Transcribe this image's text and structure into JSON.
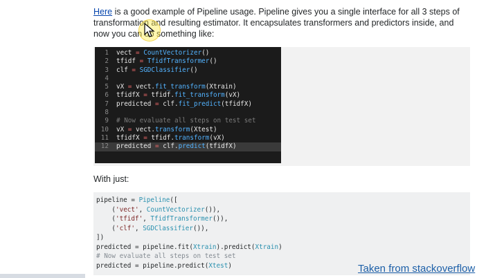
{
  "intro": {
    "link_text": "Here",
    "text": " is a good example of Pipeline usage. Pipeline gives you a single interface for all 3 steps of transformation and resulting estimator. It encapsulates transformers and predictors inside, and now you can do something like:"
  },
  "dark_code": {
    "lines": [
      {
        "num": "1",
        "parts": [
          [
            "pl",
            "vect "
          ],
          [
            "op",
            "="
          ],
          [
            "pl",
            " "
          ],
          [
            "fn",
            "CountVectorizer"
          ],
          [
            "pl",
            "()"
          ]
        ]
      },
      {
        "num": "2",
        "parts": [
          [
            "pl",
            "tfidf "
          ],
          [
            "op",
            "="
          ],
          [
            "pl",
            " "
          ],
          [
            "fn",
            "TfidfTransformer"
          ],
          [
            "pl",
            "()"
          ]
        ]
      },
      {
        "num": "3",
        "parts": [
          [
            "pl",
            "clf "
          ],
          [
            "op",
            "="
          ],
          [
            "pl",
            " "
          ],
          [
            "fn",
            "SGDClassifier"
          ],
          [
            "pl",
            "()"
          ]
        ]
      },
      {
        "num": "4",
        "parts": []
      },
      {
        "num": "5",
        "parts": [
          [
            "pl",
            "vX "
          ],
          [
            "op",
            "="
          ],
          [
            "pl",
            " vect."
          ],
          [
            "fn",
            "fit_transform"
          ],
          [
            "pl",
            "(Xtrain)"
          ]
        ]
      },
      {
        "num": "6",
        "parts": [
          [
            "pl",
            "tfidfX "
          ],
          [
            "op",
            "="
          ],
          [
            "pl",
            " tfidf."
          ],
          [
            "fn",
            "fit_transform"
          ],
          [
            "pl",
            "(vX)"
          ]
        ]
      },
      {
        "num": "7",
        "parts": [
          [
            "pl",
            "predicted "
          ],
          [
            "op",
            "="
          ],
          [
            "pl",
            " clf."
          ],
          [
            "fn",
            "fit_predict"
          ],
          [
            "pl",
            "(tfidfX)"
          ]
        ]
      },
      {
        "num": "8",
        "parts": []
      },
      {
        "num": "9",
        "parts": [
          [
            "cm",
            "# Now evaluate all steps on test set"
          ]
        ]
      },
      {
        "num": "10",
        "parts": [
          [
            "pl",
            "vX "
          ],
          [
            "op",
            "="
          ],
          [
            "pl",
            " vect."
          ],
          [
            "fn",
            "transform"
          ],
          [
            "pl",
            "(Xtest)"
          ]
        ]
      },
      {
        "num": "11",
        "parts": [
          [
            "pl",
            "tfidfX "
          ],
          [
            "op",
            "="
          ],
          [
            "pl",
            " tfidf."
          ],
          [
            "fn",
            "transform"
          ],
          [
            "pl",
            "(vX)"
          ]
        ]
      },
      {
        "num": "12",
        "parts": [
          [
            "pl",
            "predicted "
          ],
          [
            "op",
            "="
          ],
          [
            "pl",
            " clf."
          ],
          [
            "fn",
            "predict"
          ],
          [
            "pl",
            "(tfidfX)"
          ]
        ],
        "highlight": true
      }
    ]
  },
  "with_just": "With just:",
  "light_code": {
    "lines": [
      [
        [
          "pl",
          "pipeline = "
        ],
        [
          "kw",
          "Pipeline"
        ],
        [
          "pl",
          "(["
        ]
      ],
      [
        [
          "pl",
          "    ("
        ],
        [
          "str",
          "'vect'"
        ],
        [
          "pl",
          ", "
        ],
        [
          "kw",
          "CountVectorizer"
        ],
        [
          "pl",
          "()),"
        ]
      ],
      [
        [
          "pl",
          "    ("
        ],
        [
          "str",
          "'tfidf'"
        ],
        [
          "pl",
          ", "
        ],
        [
          "kw",
          "TfidfTransformer"
        ],
        [
          "pl",
          "()),"
        ]
      ],
      [
        [
          "pl",
          "    ("
        ],
        [
          "str",
          "'clf'"
        ],
        [
          "pl",
          ", "
        ],
        [
          "kw",
          "SGDClassifier"
        ],
        [
          "pl",
          "()),"
        ]
      ],
      [
        [
          "pl",
          "])"
        ]
      ],
      [
        [
          "pl",
          "predicted = pipeline.fit("
        ],
        [
          "kw",
          "Xtrain"
        ],
        [
          "pl",
          ").predict("
        ],
        [
          "kw",
          "Xtrain"
        ],
        [
          "pl",
          ")"
        ]
      ],
      [
        [
          "cm",
          "# Now evaluate all steps on test set"
        ]
      ],
      [
        [
          "pl",
          "predicted = pipeline.predict("
        ],
        [
          "kw",
          "Xtest"
        ],
        [
          "pl",
          ")"
        ]
      ]
    ]
  },
  "credit": "Taken from stackoverflow",
  "icons": {
    "cursor": "mouse-pointer-icon"
  }
}
